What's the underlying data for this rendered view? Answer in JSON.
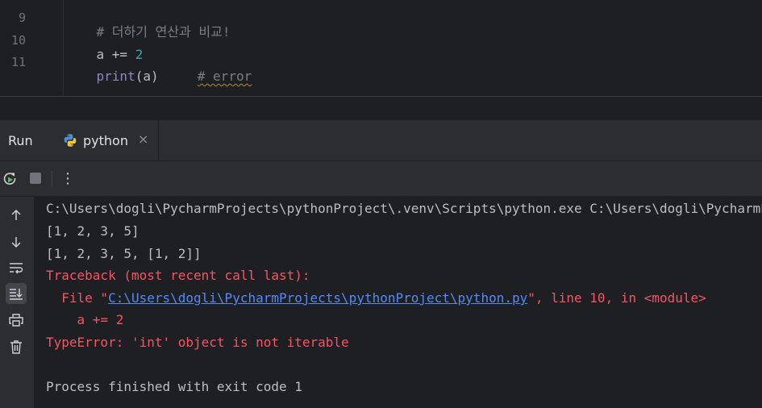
{
  "editor": {
    "line_numbers": [
      "9",
      "10",
      "11"
    ],
    "lines": [
      {
        "comment": "# 더하기 연산과 비교!"
      },
      {
        "var": "a += ",
        "num": "2"
      },
      {
        "fn": "print",
        "args": "(a)",
        "spacer": "     ",
        "comment": "# error"
      }
    ]
  },
  "run_panel": {
    "title": "Run",
    "tab": {
      "label": "python",
      "close": "×"
    },
    "toolbar": {
      "rerun_icon": "rerun-icon",
      "stop_icon": "stop-icon",
      "more_icon": "more-vertical-icon",
      "more": "⋮"
    },
    "sidebar_icons": [
      "arrow-up-icon",
      "arrow-down-icon",
      "soft-wrap-icon",
      "scroll-to-end-icon",
      "print-icon",
      "trash-icon"
    ],
    "console": {
      "command": "C:\\Users\\dogli\\PycharmProjects\\pythonProject\\.venv\\Scripts\\python.exe C:\\Users\\dogli\\PycharmProjects\\pythonProject\\python.py",
      "out1": "[1, 2, 3, 5]",
      "out2": "[1, 2, 3, 5, [1, 2]]",
      "traceback": "Traceback (most recent call last):",
      "file_prefix": "  File \"",
      "file_path": "C:\\Users\\dogli\\PycharmProjects\\pythonProject\\python.py",
      "file_suffix": "\", line 10, in <module>",
      "code_line": "    a += 2",
      "error": "TypeError: 'int' object is not iterable",
      "finished": "Process finished with exit code 1"
    }
  },
  "colors": {
    "background": "#1e1f22",
    "panel": "#2b2d30",
    "error_red": "#f75464",
    "link_blue": "#548af7",
    "number_cyan": "#2aacb8",
    "builtin_purple": "#8888c6",
    "comment_gray": "#7a7e85"
  }
}
